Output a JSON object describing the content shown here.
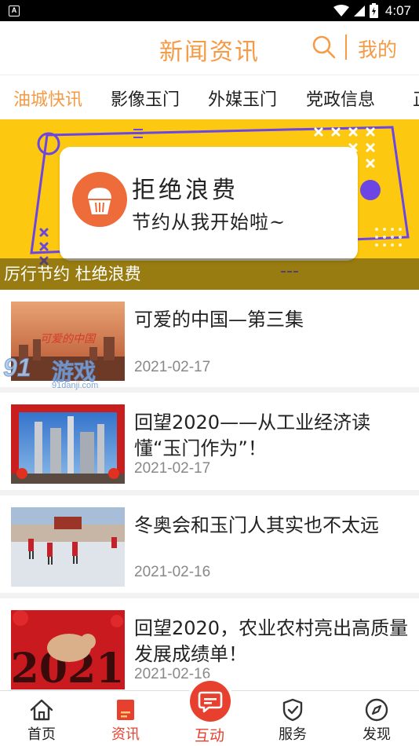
{
  "status_bar": {
    "app_badge": "A",
    "time": "4:07",
    "icons": [
      "wifi-icon",
      "signal-icon",
      "battery-icon"
    ]
  },
  "header": {
    "title": "新闻资讯",
    "mine_label": "我的",
    "search_icon": "search-icon",
    "accent_color": "#f59a45"
  },
  "tabs": [
    {
      "label": "油城快讯",
      "active": true
    },
    {
      "label": "影像玉门",
      "active": false
    },
    {
      "label": "外媒玉门",
      "active": false
    },
    {
      "label": "党政信息",
      "active": false
    },
    {
      "label": "正",
      "active": false
    }
  ],
  "banner": {
    "headline": "拒绝浪费",
    "subline": "节约从我开始啦~",
    "caption": "厉行节约 杜绝浪费",
    "background_color": "#fdc910"
  },
  "news": [
    {
      "title": "可爱的中国—第三集",
      "date": "2021-02-17",
      "thumb_text": "可爱的中国"
    },
    {
      "title": "回望2020——从工业经济读懂“玉门作为”！",
      "date": "2021-02-17"
    },
    {
      "title": "冬奥会和玉门人其实也不太远",
      "date": "2021-02-16"
    },
    {
      "title": "回望2020，农业农村亮出高质量发展成绩单！",
      "date": "2021-02-16",
      "thumb_text": "2021"
    }
  ],
  "watermark": {
    "number": "91",
    "text": "游戏",
    "url": "91danji.com"
  },
  "bottom_nav": [
    {
      "label": "首页",
      "icon": "home-icon",
      "active": false
    },
    {
      "label": "资讯",
      "icon": "news-icon",
      "active": true
    },
    {
      "label": "互动",
      "icon": "chat-icon",
      "active": false,
      "center": true
    },
    {
      "label": "服务",
      "icon": "shield-icon",
      "active": false
    },
    {
      "label": "发现",
      "icon": "compass-icon",
      "active": false
    }
  ],
  "colors": {
    "accent": "#f59a45",
    "nav_active": "#e8402e"
  }
}
